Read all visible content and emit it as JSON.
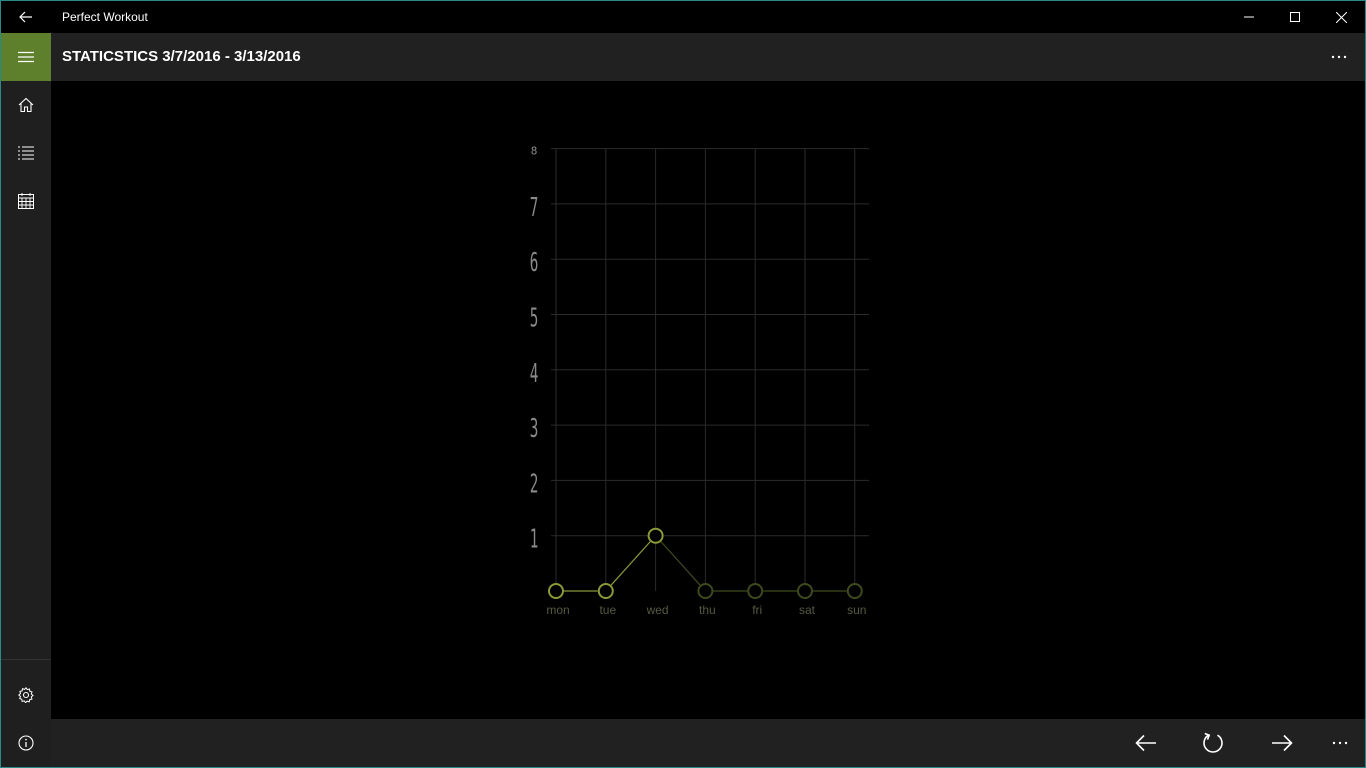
{
  "window": {
    "app_title": "Perfect Workout"
  },
  "header": {
    "title": "STATICSTICS 3/7/2016 - 3/13/2016"
  },
  "nav": {
    "items": [
      {
        "name": "home",
        "icon": "home-icon"
      },
      {
        "name": "list",
        "icon": "list-icon"
      },
      {
        "name": "calendar",
        "icon": "calendar-icon"
      },
      {
        "name": "settings",
        "icon": "gear-icon"
      },
      {
        "name": "info",
        "icon": "info-icon"
      }
    ]
  },
  "colors": {
    "accent": "#5e7f2c",
    "point_active": "#8a9a3a",
    "point_dim": "#3d4a1e",
    "grid": "#2b2b2b",
    "tick": "#8a8a8a",
    "day_label": "#555a40"
  },
  "chart_data": {
    "type": "line",
    "categories": [
      "mon",
      "tue",
      "wed",
      "thu",
      "fri",
      "sat",
      "sun"
    ],
    "series": [
      {
        "values": [
          0,
          0,
          1,
          0,
          0,
          0,
          0
        ]
      }
    ],
    "y_ticks": [
      "1",
      "2",
      "3",
      "4",
      "5",
      "6",
      "7",
      "8"
    ],
    "ylim": [
      0,
      8
    ],
    "grid": true,
    "highlighted_days": [
      "mon",
      "tue",
      "wed"
    ]
  }
}
